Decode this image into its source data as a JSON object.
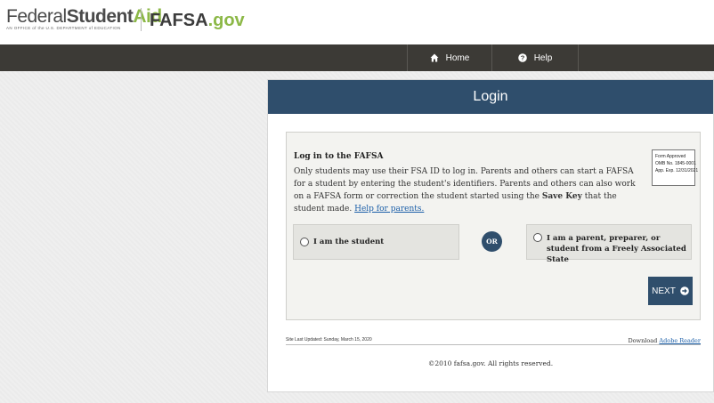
{
  "header": {
    "logo_federal": "Federal",
    "logo_student": "Student",
    "logo_aid": "Aid",
    "logo_subtitle": "AN OFFICE of the U.S. DEPARTMENT of EDUCATION",
    "fafsa_part1": "FAFSA",
    "fafsa_part2": ".gov"
  },
  "nav": {
    "home_label": "Home",
    "help_label": "Help"
  },
  "panel": {
    "title": "Login"
  },
  "login": {
    "heading": "Log in to the FAFSA",
    "text_1": "Only students may use their FSA ID to log in. Parents and others can start a FAFSA for a student by entering the student's identifiers. Parents and others can also work on a FAFSA form or correction the student started using the ",
    "text_bold": "Save Key",
    "text_2": " that the student made. ",
    "help_link": "Help for parents.",
    "form_approved_1": "Form Approved",
    "form_approved_2": "OMB No. 1845-0001",
    "form_approved_3": "App. Exp. 12/31/2021",
    "option_student": "I am the student",
    "or_label": "OR",
    "option_parent": "I am a parent, preparer, or student from a Freely Associated State",
    "next_label": "NEXT"
  },
  "footer": {
    "site_updated": "Site Last Updated: Sunday, March 15, 2020",
    "download_text": "Download ",
    "download_link": "Adobe Reader",
    "copyright": "©2010 fafsa.gov. All rights reserved."
  },
  "colors": {
    "navbar": "#3c3a36",
    "panel_header": "#2f4e6c",
    "brand_green": "#8cb847",
    "link": "#1a5ea8"
  },
  "icons": {
    "home": "home-icon",
    "help": "question-circle-icon",
    "next": "arrow-right-circle-icon"
  }
}
